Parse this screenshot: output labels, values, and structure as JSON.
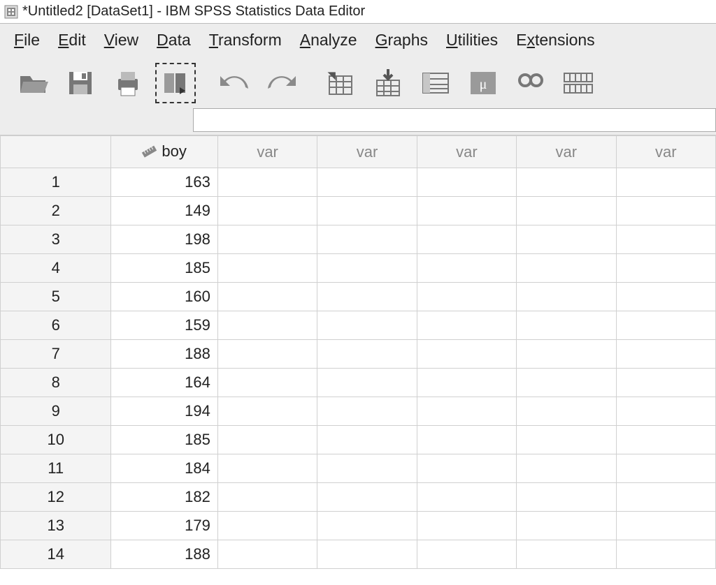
{
  "window": {
    "title": "*Untitled2 [DataSet1] - IBM SPSS Statistics Data Editor"
  },
  "menu": {
    "items": [
      {
        "label": "File",
        "ul": "F"
      },
      {
        "label": "Edit",
        "ul": "E"
      },
      {
        "label": "View",
        "ul": "V"
      },
      {
        "label": "Data",
        "ul": "D"
      },
      {
        "label": "Transform",
        "ul": "T"
      },
      {
        "label": "Analyze",
        "ul": "A"
      },
      {
        "label": "Graphs",
        "ul": "G"
      },
      {
        "label": "Utilities",
        "ul": "U"
      },
      {
        "label": "Extensions",
        "ul": "x"
      }
    ]
  },
  "toolbar": {
    "buttons": [
      {
        "name": "open-icon"
      },
      {
        "name": "save-icon"
      },
      {
        "name": "print-icon"
      },
      {
        "name": "recall-dialog-icon",
        "selected": true
      },
      {
        "name": "undo-icon"
      },
      {
        "name": "redo-icon"
      },
      {
        "name": "goto-case-icon"
      },
      {
        "name": "goto-variable-icon"
      },
      {
        "name": "variables-icon"
      },
      {
        "name": "run-descriptives-icon"
      },
      {
        "name": "find-icon"
      },
      {
        "name": "split-file-icon"
      }
    ]
  },
  "grid": {
    "columns": [
      {
        "name": "boy",
        "type": "scale"
      },
      {
        "name": "var"
      },
      {
        "name": "var"
      },
      {
        "name": "var"
      },
      {
        "name": "var"
      },
      {
        "name": "var"
      }
    ],
    "rows": [
      {
        "n": 1,
        "boy": 163
      },
      {
        "n": 2,
        "boy": 149
      },
      {
        "n": 3,
        "boy": 198
      },
      {
        "n": 4,
        "boy": 185
      },
      {
        "n": 5,
        "boy": 160
      },
      {
        "n": 6,
        "boy": 159
      },
      {
        "n": 7,
        "boy": 188
      },
      {
        "n": 8,
        "boy": 164
      },
      {
        "n": 9,
        "boy": 194
      },
      {
        "n": 10,
        "boy": 185
      },
      {
        "n": 11,
        "boy": 184
      },
      {
        "n": 12,
        "boy": 182
      },
      {
        "n": 13,
        "boy": 179
      },
      {
        "n": 14,
        "boy": 188
      }
    ]
  }
}
